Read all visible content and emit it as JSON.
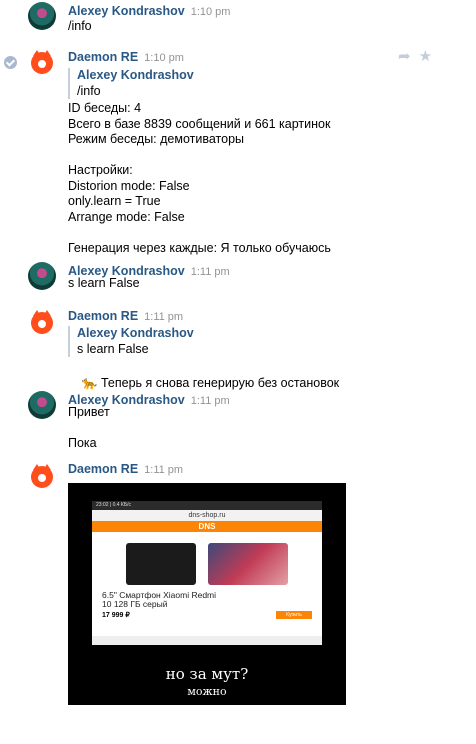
{
  "messages": [
    {
      "author": "Alexey Kondrashov",
      "time": "1:10 pm",
      "text": "/info"
    },
    {
      "author": "Daemon RE",
      "time": "1:10 pm",
      "quote": {
        "author": "Alexey Kondrashov",
        "text": "/info"
      },
      "text": "ID беседы: 4\nВсего в базе 8839 сообщений и 661 картинок\nРежим беседы: демотиваторы\n\nНастройки:\nDistorion mode: False\nonly.learn = True\nArrange mode: False\n\nГенерация через каждые: Я только обучаюсь"
    },
    {
      "author": "Alexey Kondrashov",
      "time": "1:11 pm",
      "text": "s learn False"
    },
    {
      "author": "Daemon RE",
      "time": "1:11 pm",
      "quote": {
        "author": "Alexey Kondrashov",
        "text": "s learn False"
      },
      "emoji": "🐆",
      "text": "Теперь я снова генерирую без остановок"
    },
    {
      "author": "Alexey Kondrashov",
      "time": "1:11 pm",
      "text": "Привет\n\nПока"
    },
    {
      "author": "Daemon RE",
      "time": "1:11 pm",
      "image": {
        "caption_top": "но за мут?",
        "caption_bottom": "можно",
        "screenshot": {
          "site": "dns-shop.ru",
          "brand": "DNS",
          "product_title": "6.5\" Смартфон Xiaomi Redmi\n10 128 ГБ серый",
          "price": "17 999 ₽",
          "buy": "Купить"
        }
      }
    }
  ],
  "colors": {
    "author": "#2a5885",
    "time": "#939393",
    "daemon_avatar": "#ff4e1c",
    "brand": "#fc8507"
  }
}
